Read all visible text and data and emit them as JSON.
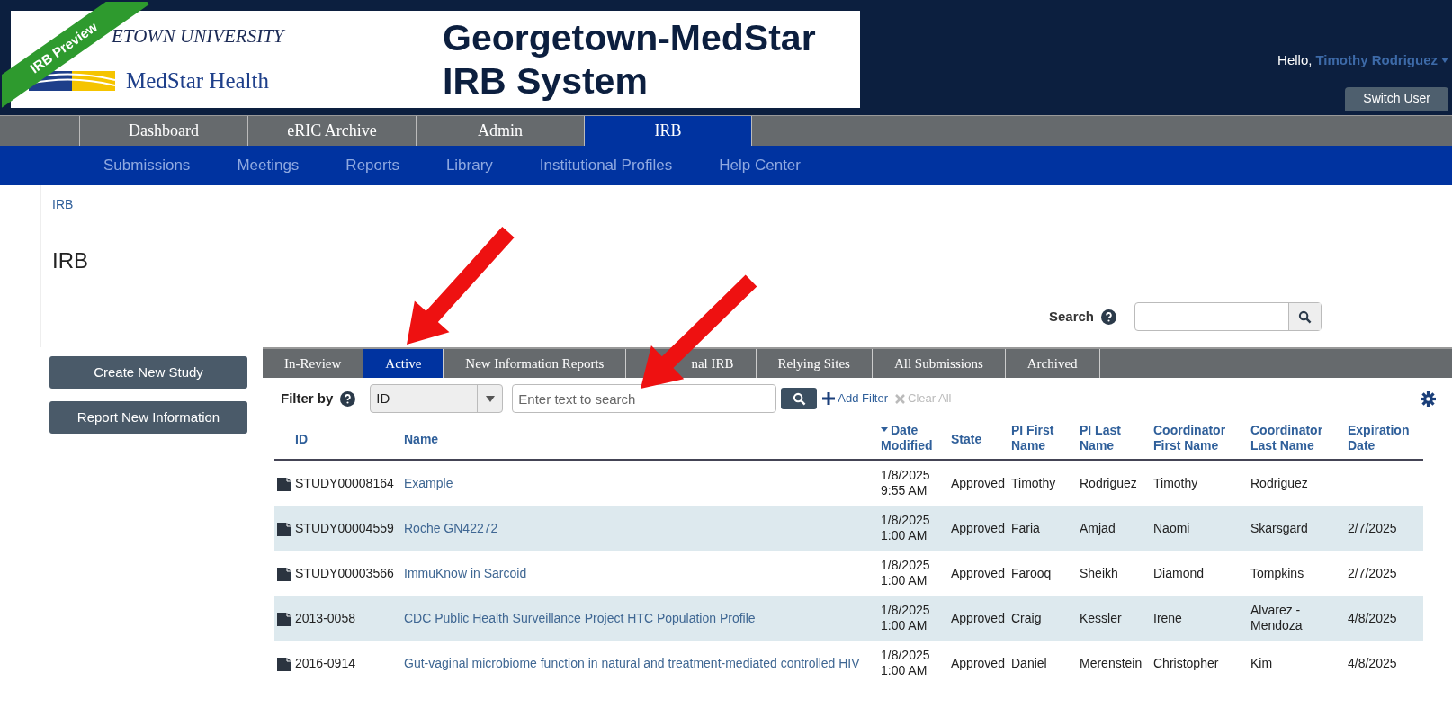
{
  "header": {
    "ribbon": "IRB Preview",
    "logo_top": "ETOWN UNIVERSITY",
    "logo_bottom": "MedStar Health",
    "title_lines": [
      "Georgetown-MedStar",
      "IRB System"
    ],
    "greeting": "Hello,",
    "user": "Timothy Rodriguez",
    "switch_user": "Switch User"
  },
  "nav": [
    {
      "label": "Dashboard",
      "selected": false
    },
    {
      "label": "eRIC Archive",
      "selected": false
    },
    {
      "label": "Admin",
      "selected": false
    },
    {
      "label": "IRB",
      "selected": true
    }
  ],
  "subnav": [
    "Submissions",
    "Meetings",
    "Reports",
    "Library",
    "Institutional Profiles",
    "Help Center"
  ],
  "breadcrumb": "IRB",
  "heading": "IRB",
  "search": {
    "label": "Search"
  },
  "actions": [
    "Create New Study",
    "Report New Information"
  ],
  "tabs": [
    {
      "label": "In-Review",
      "selected": false
    },
    {
      "label": "Active",
      "selected": true
    },
    {
      "label": "New Information Reports",
      "selected": false
    },
    {
      "label": "nal IRB",
      "selected": false
    },
    {
      "label": "Relying Sites",
      "selected": false
    },
    {
      "label": "All Submissions",
      "selected": false
    },
    {
      "label": "Archived",
      "selected": false
    }
  ],
  "filter": {
    "label": "Filter by",
    "field": "ID",
    "placeholder": "Enter text to search",
    "add": "Add Filter",
    "clear": "Clear All"
  },
  "table": {
    "columns": [
      {
        "label": "ID",
        "sorted": false
      },
      {
        "label": "Name",
        "sorted": false
      },
      {
        "label": "Date Modified",
        "sorted": true
      },
      {
        "label": "State",
        "sorted": false
      },
      {
        "label": "PI First Name",
        "sorted": false
      },
      {
        "label": "PI Last Name",
        "sorted": false
      },
      {
        "label": "Coordinator First Name",
        "sorted": false
      },
      {
        "label": "Coordinator Last Name",
        "sorted": false
      },
      {
        "label": "Expiration Date",
        "sorted": false
      }
    ],
    "rows": [
      {
        "cells": [
          "STUDY00008164",
          "Example",
          "1/8/2025 9:55 AM",
          "Approved",
          "Timothy",
          "Rodriguez",
          "Timothy",
          "Rodriguez",
          ""
        ]
      },
      {
        "cells": [
          "STUDY00004559",
          "Roche GN42272",
          "1/8/2025 1:00 AM",
          "Approved",
          "Faria",
          "Amjad",
          "Naomi",
          "Skarsgard",
          "2/7/2025"
        ]
      },
      {
        "cells": [
          "STUDY00003566",
          "ImmuKnow in Sarcoid",
          "1/8/2025 1:00 AM",
          "Approved",
          "Farooq",
          "Sheikh",
          "Diamond",
          "Tompkins",
          "2/7/2025"
        ]
      },
      {
        "cells": [
          "2013-0058",
          "CDC Public Health Surveillance Project HTC Population Profile",
          "1/8/2025 1:00 AM",
          "Approved",
          "Craig",
          "Kessler",
          "Irene",
          "Alvarez - Mendoza",
          "4/8/2025"
        ]
      },
      {
        "cells": [
          "2016-0914",
          "Gut-vaginal microbiome function in natural and treatment-mediated controlled HIV",
          "1/8/2025 1:00 AM",
          "Approved",
          "Daniel",
          "Merenstein",
          "Christopher",
          "Kim",
          "4/8/2025"
        ]
      }
    ]
  }
}
